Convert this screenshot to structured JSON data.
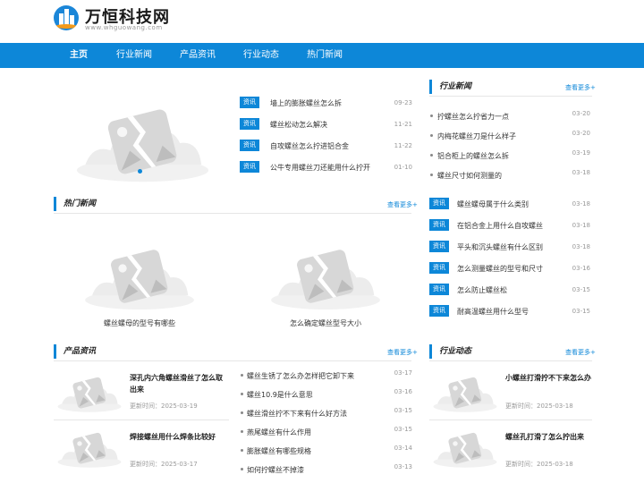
{
  "site": {
    "name": "万恒科技网",
    "url": "www.whguowang.com"
  },
  "nav": [
    {
      "label": "主页"
    },
    {
      "label": "行业新闻"
    },
    {
      "label": "产品资讯"
    },
    {
      "label": "行业动态"
    },
    {
      "label": "热门新闻"
    }
  ],
  "headline": [
    {
      "tag": "资讯",
      "title": "墙上的膨胀螺丝怎么拆",
      "date": "09-23"
    },
    {
      "tag": "资讯",
      "title": "螺丝松动怎么解决",
      "date": "11-21"
    },
    {
      "tag": "资讯",
      "title": "自攻螺丝怎么拧进铝合金",
      "date": "11-22"
    },
    {
      "tag": "资讯",
      "title": "公牛专用螺丝刀还能用什么拧开",
      "date": "01-10"
    }
  ],
  "more_label": "查看更多+",
  "industry_news": {
    "title": "行业新闻",
    "bullets": [
      {
        "title": "拧螺丝怎么拧省力一点",
        "date": "03-20"
      },
      {
        "title": "内梅花螺丝刀是什么样子",
        "date": "03-20"
      },
      {
        "title": "铝合柜上的螺丝怎么拆",
        "date": "03-19"
      },
      {
        "title": "螺丝尺寸如何测量的",
        "date": "03-18"
      }
    ],
    "tagged": [
      {
        "tag": "资讯",
        "title": "螺丝螺母属于什么类别",
        "date": "03-18"
      },
      {
        "tag": "资讯",
        "title": "在铝合金上用什么自攻螺丝",
        "date": "03-18"
      },
      {
        "tag": "资讯",
        "title": "平头和沉头螺丝有什么区别",
        "date": "03-18"
      },
      {
        "tag": "资讯",
        "title": "怎么测量螺丝的型号和尺寸",
        "date": "03-16"
      },
      {
        "tag": "资讯",
        "title": "怎么防止螺丝松",
        "date": "03-15"
      },
      {
        "tag": "资讯",
        "title": "耐高温螺丝用什么型号",
        "date": "03-15"
      }
    ]
  },
  "hot_news": {
    "title": "热门新闻",
    "items": [
      {
        "caption": "螺丝螺母的型号有哪些"
      },
      {
        "caption": "怎么确定螺丝型号大小"
      }
    ]
  },
  "product_news": {
    "title": "产品资讯",
    "cards": [
      {
        "title": "深孔内六角螺丝滑丝了怎么取出来",
        "date": "更新时间：2025-03-19"
      },
      {
        "title": "焊接螺丝用什么焊条比较好",
        "date": "更新时间：2025-03-17"
      }
    ],
    "list": [
      {
        "title": "螺丝生锈了怎么办怎样把它卸下来",
        "date": "03-17"
      },
      {
        "title": "螺丝10.9是什么意思",
        "date": "03-16"
      },
      {
        "title": "螺丝滑丝拧不下来有什么好方法",
        "date": "03-15"
      },
      {
        "title": "燕尾螺丝有什么作用",
        "date": "03-15"
      },
      {
        "title": "膨胀螺丝有哪些规格",
        "date": "03-14"
      },
      {
        "title": "如何拧螺丝不掉漆",
        "date": "03-13"
      }
    ]
  },
  "industry_dynamics": {
    "title": "行业动态",
    "cards": [
      {
        "title": "小螺丝打滑拧不下来怎么办",
        "date": "更新时间：2025-03-18"
      },
      {
        "title": "螺丝孔打滑了怎么拧出来",
        "date": "更新时间：2025-03-18"
      }
    ]
  },
  "colors": {
    "brand": "#0d87d8",
    "text": "#333333",
    "muted": "#999999"
  }
}
